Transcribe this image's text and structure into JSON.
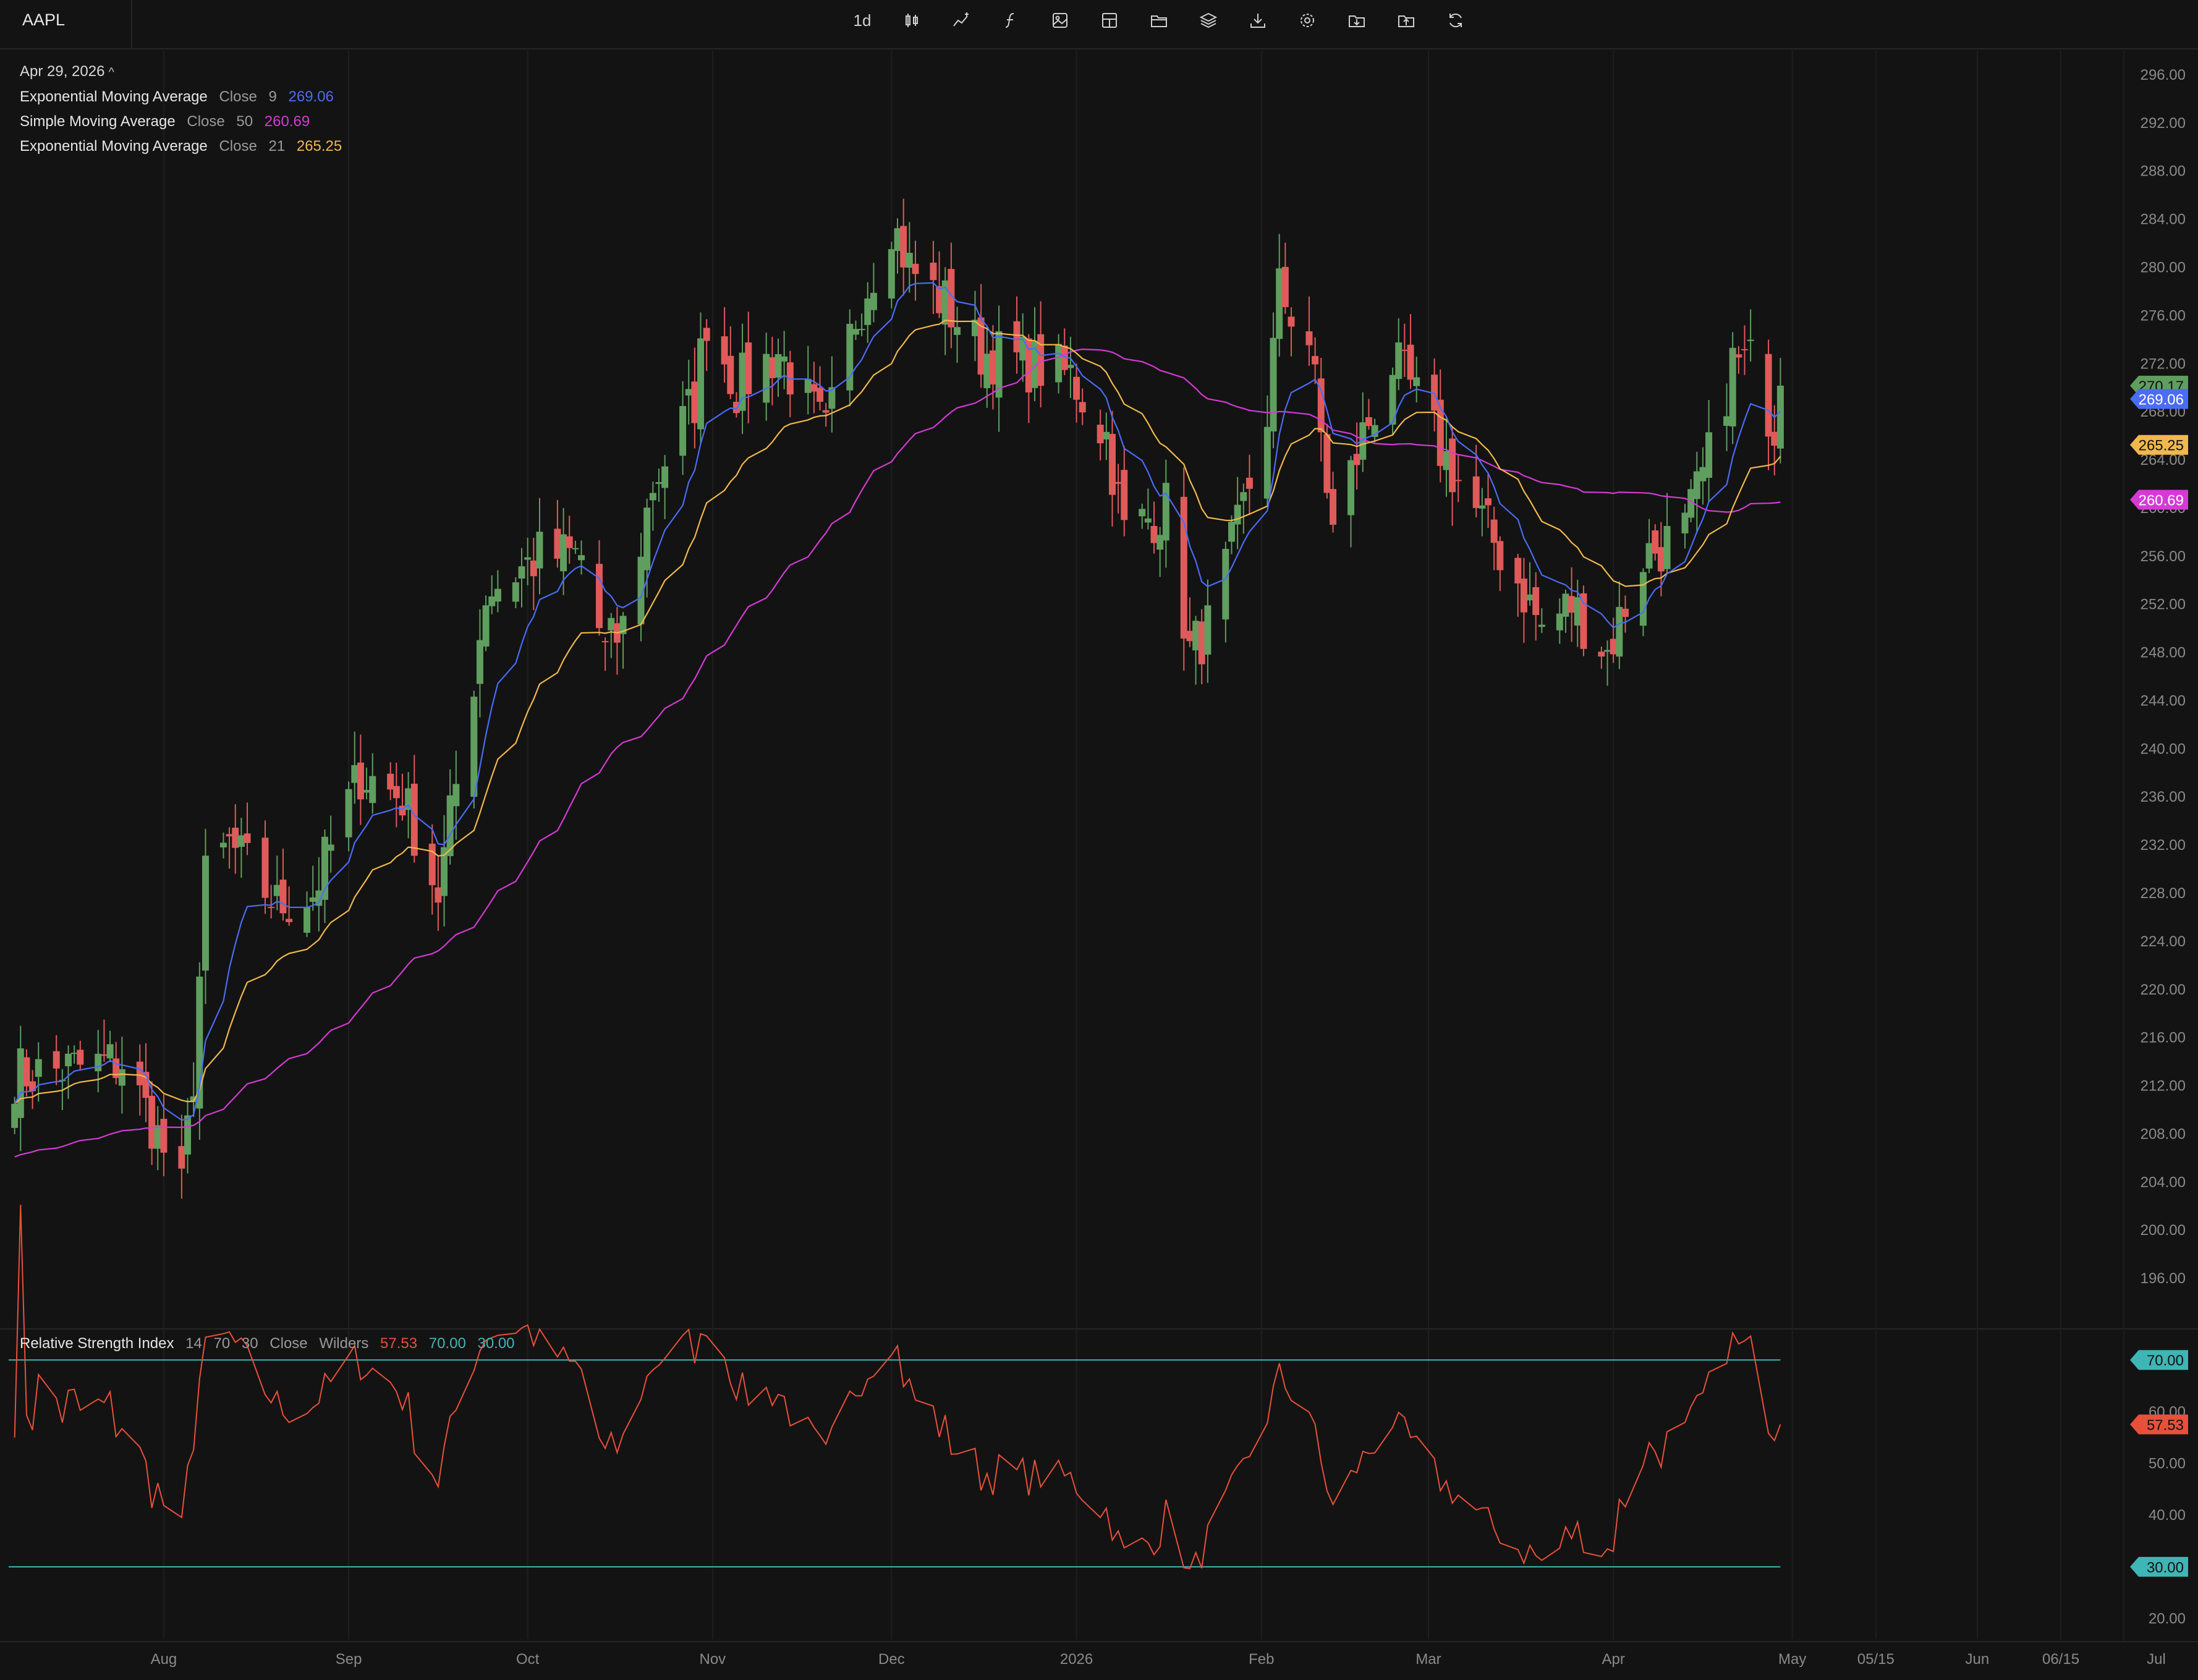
{
  "symbol": "AAPL",
  "toolbar": [
    {
      "name": "interval-button",
      "label": "1d"
    },
    {
      "name": "candle-style-icon"
    },
    {
      "name": "indicator-icon"
    },
    {
      "name": "function-icon"
    },
    {
      "name": "screenshot-icon"
    },
    {
      "name": "layout-icon"
    },
    {
      "name": "folder-icon"
    },
    {
      "name": "layers-icon"
    },
    {
      "name": "download-icon"
    },
    {
      "name": "settings-icon"
    },
    {
      "name": "import-icon"
    },
    {
      "name": "export-icon"
    },
    {
      "name": "refresh-icon"
    }
  ],
  "legend": {
    "date": "Apr 29, 2026",
    "indicators": [
      {
        "name": "Exponential Moving Average",
        "source": "Close",
        "period": "9",
        "value": "269.06",
        "color": "#4a6cf7"
      },
      {
        "name": "Simple Moving Average",
        "source": "Close",
        "period": "50",
        "value": "260.69",
        "color": "#d63ad6"
      },
      {
        "name": "Exponential Moving Average",
        "source": "Close",
        "period": "21",
        "value": "265.25",
        "color": "#f2b84b"
      }
    ]
  },
  "rsi_legend": {
    "name": "Relative Strength Index",
    "period": "14",
    "upper": "70",
    "lower": "30",
    "source": "Close",
    "smoothing": "Wilders",
    "value": "57.53",
    "upper_value": "70.00",
    "lower_value": "30.00",
    "value_color": "#e8503a",
    "band_color": "#3fb5b5"
  },
  "colors": {
    "up": "#5f9e5f",
    "down": "#e05a5a",
    "ema9": "#4a6cf7",
    "sma50": "#d63ad6",
    "ema21": "#f2b84b",
    "rsi": "#e8503a",
    "band": "#3fb5b5",
    "last_price_badge": "#5f9e5f"
  },
  "chart_data": [
    {
      "type": "candlestick",
      "title": "AAPL",
      "interval": "1d",
      "x_range": [
        "2025-07-06",
        "2026-07-08"
      ],
      "ylim": [
        192,
        298
      ],
      "yticks": [
        196,
        200,
        204,
        208,
        212,
        216,
        220,
        224,
        228,
        232,
        236,
        240,
        244,
        248,
        252,
        256,
        260,
        264,
        268,
        272,
        276,
        280,
        284,
        288,
        292,
        296
      ],
      "xticks": [
        {
          "label": "Aug",
          "date": "2025-08-01"
        },
        {
          "label": "Sep",
          "date": "2025-09-01"
        },
        {
          "label": "Oct",
          "date": "2025-10-01"
        },
        {
          "label": "Nov",
          "date": "2025-11-01"
        },
        {
          "label": "Dec",
          "date": "2025-12-01"
        },
        {
          "label": "2026",
          "date": "2026-01-01"
        },
        {
          "label": "Feb",
          "date": "2026-02-01"
        },
        {
          "label": "Mar",
          "date": "2026-03-01"
        },
        {
          "label": "Apr",
          "date": "2026-04-01"
        },
        {
          "label": "May",
          "date": "2026-05-01"
        },
        {
          "label": "05/15",
          "date": "2026-05-15"
        },
        {
          "label": "Jun",
          "date": "2026-06-01"
        },
        {
          "label": "06/15",
          "date": "2026-06-15"
        },
        {
          "label": "Jul",
          "date": "2026-07-01"
        }
      ],
      "close_key_points": [
        [
          "2025-07-10",
          213
        ],
        [
          "2025-07-25",
          214
        ],
        [
          "2025-07-30",
          209
        ],
        [
          "2025-08-04",
          203
        ],
        [
          "2025-08-06",
          213
        ],
        [
          "2025-08-08",
          229
        ],
        [
          "2025-08-12",
          232
        ],
        [
          "2025-08-20",
          227
        ],
        [
          "2025-08-26",
          228
        ],
        [
          "2025-09-03",
          238
        ],
        [
          "2025-09-10",
          236
        ],
        [
          "2025-09-16",
          228
        ],
        [
          "2025-09-22",
          246
        ],
        [
          "2025-09-24",
          253
        ],
        [
          "2025-10-03",
          256
        ],
        [
          "2025-10-10",
          256
        ],
        [
          "2025-10-14",
          248
        ],
        [
          "2025-10-17",
          250
        ],
        [
          "2025-10-22",
          262
        ],
        [
          "2025-10-29",
          269
        ],
        [
          "2025-10-31",
          276
        ],
        [
          "2025-11-05",
          270
        ],
        [
          "2025-11-12",
          273
        ],
        [
          "2025-11-20",
          266
        ],
        [
          "2025-11-25",
          276
        ],
        [
          "2025-12-01",
          284
        ],
        [
          "2025-12-04",
          280
        ],
        [
          "2025-12-10",
          277
        ],
        [
          "2025-12-16",
          273
        ],
        [
          "2025-12-24",
          272
        ],
        [
          "2025-12-31",
          271
        ],
        [
          "2026-01-06",
          266
        ],
        [
          "2026-01-09",
          258
        ],
        [
          "2026-01-16",
          260
        ],
        [
          "2026-01-20",
          248
        ],
        [
          "2026-01-23",
          250
        ],
        [
          "2026-01-28",
          258
        ],
        [
          "2026-02-02",
          268
        ],
        [
          "2026-02-04",
          278
        ],
        [
          "2026-02-09",
          274
        ],
        [
          "2026-02-13",
          258
        ],
        [
          "2026-02-18",
          266
        ],
        [
          "2026-02-23",
          272
        ],
        [
          "2026-02-26",
          270
        ],
        [
          "2026-03-04",
          264
        ],
        [
          "2026-03-11",
          258
        ],
        [
          "2026-03-16",
          254
        ],
        [
          "2026-03-20",
          250
        ],
        [
          "2026-03-25",
          252
        ],
        [
          "2026-03-31",
          248
        ],
        [
          "2026-04-06",
          256
        ],
        [
          "2026-04-13",
          258
        ],
        [
          "2026-04-17",
          264
        ],
        [
          "2026-04-21",
          272
        ],
        [
          "2026-04-24",
          272
        ],
        [
          "2026-04-28",
          267
        ],
        [
          "2026-04-29",
          270.17
        ]
      ],
      "last_price": 270.17,
      "series": [
        {
          "name": "Exponential Moving Average",
          "period": 9,
          "last": 269.06
        },
        {
          "name": "Simple Moving Average",
          "period": 50,
          "last": 260.69
        },
        {
          "name": "Exponential Moving Average",
          "period": 21,
          "last": 265.25
        }
      ],
      "price_labels": [
        "270.17",
        "269.06",
        "265.25",
        "260.69"
      ]
    },
    {
      "type": "line",
      "title": "Relative Strength Index",
      "ylim": [
        16,
        76
      ],
      "yticks": [
        20,
        30,
        40,
        50,
        60,
        70
      ],
      "bands": [
        70,
        30
      ],
      "last": 57.53,
      "price_labels": [
        "70.00",
        "57.53",
        "30.00"
      ]
    }
  ]
}
